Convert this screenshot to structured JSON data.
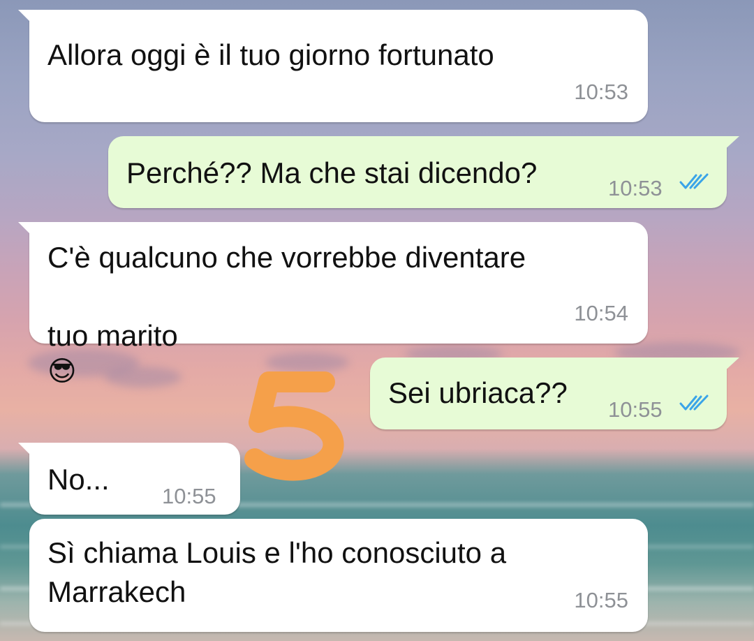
{
  "messages": [
    {
      "id": "m1",
      "direction": "incoming",
      "text": "Allora oggi è il tuo giorno fortunato",
      "time": "10:53"
    },
    {
      "id": "m2",
      "direction": "outgoing",
      "text": "Perché?? Ma che stai dicendo?",
      "time": "10:53",
      "status": "read"
    },
    {
      "id": "m3",
      "direction": "incoming",
      "text": "C'è qualcuno che vorrebbe diventare",
      "text_line2": "tuo marito",
      "emoji": "😎",
      "time": "10:54"
    },
    {
      "id": "m4",
      "direction": "outgoing",
      "text": "Sei ubriaca??",
      "time": "10:55",
      "status": "read"
    },
    {
      "id": "m5",
      "direction": "incoming",
      "text": "No...",
      "time": "10:55"
    },
    {
      "id": "m6",
      "direction": "incoming",
      "text": "Sì chiama Louis e l'ho conosciuto a",
      "text_line2": "Marrakech",
      "time": "10:55"
    }
  ],
  "overlay": {
    "number": "5",
    "color": "#f5a04a"
  },
  "colors": {
    "incoming_bubble": "#ffffff",
    "outgoing_bubble": "#e7fbd6",
    "read_ticks": "#3aa4e8",
    "timestamp": "#8e9196"
  },
  "icons": {
    "read_receipt": "double-check-icon",
    "emoji": "smiling-face-with-sunglasses-icon"
  }
}
